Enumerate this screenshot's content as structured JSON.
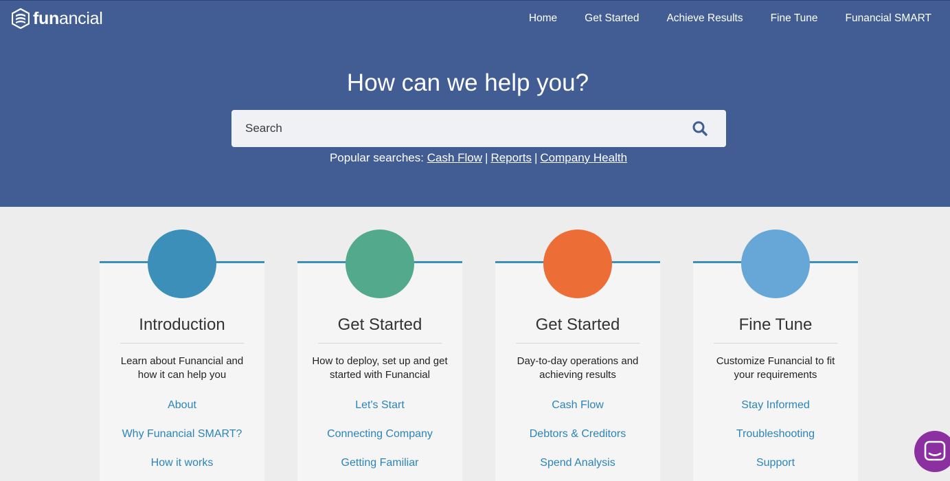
{
  "brand": {
    "name_bold": "fun",
    "name_light": "ancial",
    "logo_icon": "funancial-logo-icon",
    "hero_color": "#415d94"
  },
  "nav": {
    "items": [
      {
        "label": "Home"
      },
      {
        "label": "Get Started"
      },
      {
        "label": "Achieve Results"
      },
      {
        "label": "Fine Tune"
      },
      {
        "label": "Funancial SMART"
      }
    ]
  },
  "hero": {
    "title": "How can we help you?",
    "search": {
      "placeholder": "Search",
      "value": "",
      "icon": "search-icon"
    },
    "popular": {
      "prefix": "Popular searches:",
      "separator": "|",
      "links": [
        "Cash Flow",
        "Reports",
        "Company Health"
      ]
    }
  },
  "cards": [
    {
      "title": "Introduction",
      "description": "Learn about Funancial and how it can help you",
      "color": "#3b8fb8",
      "links": [
        "About",
        "Why Funancial SMART?",
        "How it works"
      ]
    },
    {
      "title": "Get Started",
      "description": "How to deploy, set up and get started with Funancial",
      "color": "#52a98b",
      "links": [
        "Let's Start",
        "Connecting Company",
        "Getting Familiar"
      ]
    },
    {
      "title": "Get Started",
      "description": "Day-to-day operations and achieving results",
      "color": "#ec6d35",
      "links": [
        "Cash Flow",
        "Debtors & Creditors",
        "Spend Analysis"
      ]
    },
    {
      "title": "Fine Tune",
      "description": "Customize Funancial to fit your requirements",
      "color": "#67a7d7",
      "links": [
        "Stay Informed",
        "Troubleshooting",
        "Support"
      ]
    }
  ],
  "chat": {
    "icon": "chat-icon",
    "color": "#8b2fa1"
  }
}
